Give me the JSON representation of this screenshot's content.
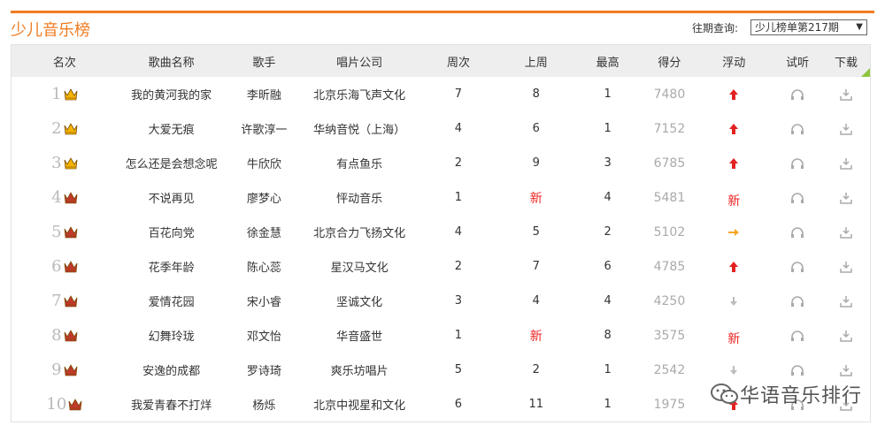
{
  "header": {
    "title": "少儿音乐榜",
    "query_label": "往期查询:",
    "query_selected": "少儿榜单第217期"
  },
  "columns": [
    "名次",
    "歌曲名称",
    "歌手",
    "唱片公司",
    "周次",
    "上周",
    "最高",
    "得分",
    "浮动",
    "试听",
    "下载"
  ],
  "rows": [
    {
      "rank": "1",
      "song": "我的黄河我的家",
      "artist": "李昕融",
      "label": "北京乐海飞声文化",
      "weeks": "7",
      "last": "8",
      "peak": "1",
      "score": "7480",
      "trend": "up",
      "last_new": false
    },
    {
      "rank": "2",
      "song": "大爱无痕",
      "artist": "许歌淳一",
      "label": "华纳音悦（上海）",
      "weeks": "4",
      "last": "6",
      "peak": "1",
      "score": "7152",
      "trend": "up",
      "last_new": false
    },
    {
      "rank": "3",
      "song": "怎么还是会想念呢",
      "artist": "牛欣欣",
      "label": "有点鱼乐",
      "weeks": "2",
      "last": "9",
      "peak": "3",
      "score": "6785",
      "trend": "up",
      "last_new": false
    },
    {
      "rank": "4",
      "song": "不说再见",
      "artist": "廖梦心",
      "label": "怦动音乐",
      "weeks": "1",
      "last": "新",
      "peak": "4",
      "score": "5481",
      "trend": "new",
      "last_new": true
    },
    {
      "rank": "5",
      "song": "百花向党",
      "artist": "徐金慧",
      "label": "北京合力飞扬文化",
      "weeks": "4",
      "last": "5",
      "peak": "2",
      "score": "5102",
      "trend": "same",
      "last_new": false
    },
    {
      "rank": "6",
      "song": "花季年龄",
      "artist": "陈心蕊",
      "label": "星汉马文化",
      "weeks": "2",
      "last": "7",
      "peak": "6",
      "score": "4785",
      "trend": "up",
      "last_new": false
    },
    {
      "rank": "7",
      "song": "爱情花园",
      "artist": "宋小睿",
      "label": "坚诚文化",
      "weeks": "3",
      "last": "4",
      "peak": "4",
      "score": "4250",
      "trend": "down",
      "last_new": false
    },
    {
      "rank": "8",
      "song": "幻舞玲珑",
      "artist": "邓文怡",
      "label": "华音盛世",
      "weeks": "1",
      "last": "新",
      "peak": "8",
      "score": "3575",
      "trend": "new",
      "last_new": true
    },
    {
      "rank": "9",
      "song": "安逸的成都",
      "artist": "罗诗琦",
      "label": "爽乐坊唱片",
      "weeks": "5",
      "last": "2",
      "peak": "1",
      "score": "2542",
      "trend": "down",
      "last_new": false
    },
    {
      "rank": "10",
      "song": "我爱青春不打烊",
      "artist": "杨烁",
      "label": "北京中视星和文化",
      "weeks": "6",
      "last": "11",
      "peak": "1",
      "score": "1975",
      "trend": "up",
      "last_new": false
    }
  ],
  "trend_new_label": "新",
  "watermark": "华语音乐排行",
  "colors": {
    "accent": "#f07c22",
    "up": "#e22222",
    "same": "#f5a623",
    "down": "#bbbbbb",
    "gold": "#f5b400",
    "red_crown": "#c0392b"
  },
  "icons": {
    "top3": "gold-crown-icon",
    "others": "red-crown-icon",
    "listen": "headphones-icon",
    "download": "download-icon",
    "up": "arrow-up-icon",
    "down": "arrow-down-icon",
    "same": "arrow-right-icon"
  }
}
